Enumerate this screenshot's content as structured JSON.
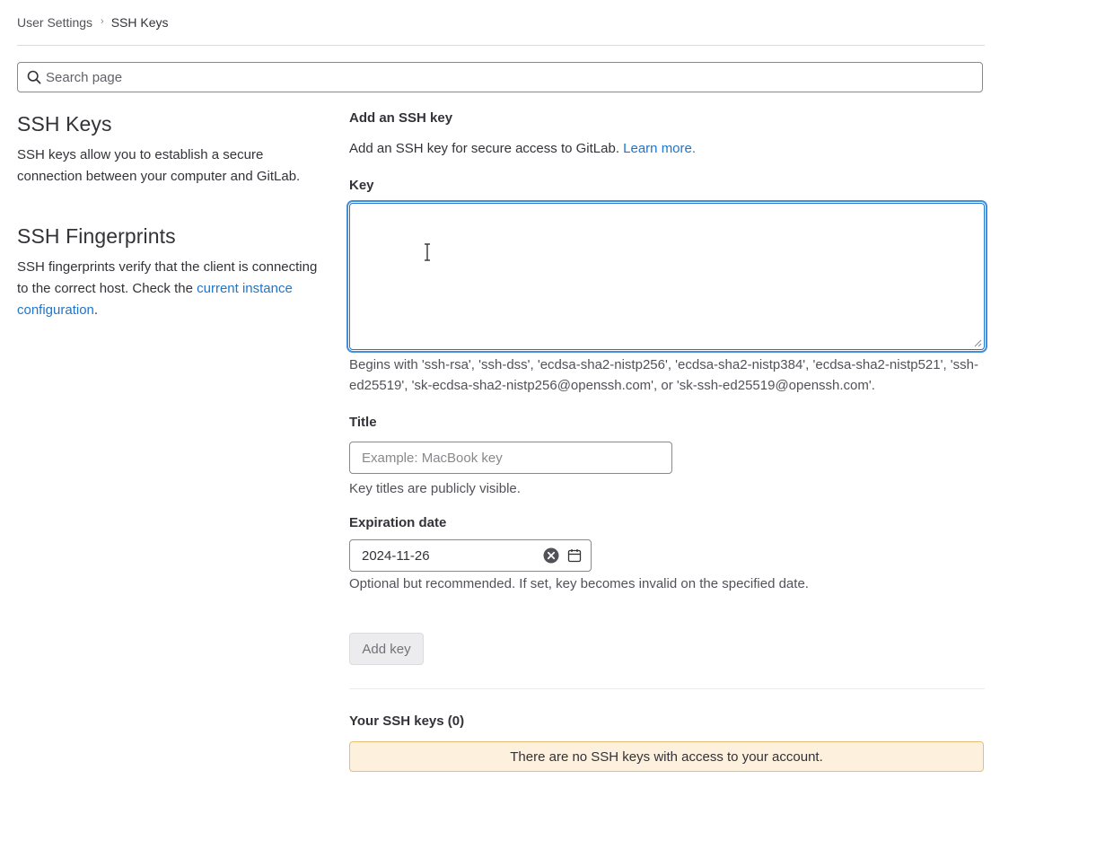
{
  "breadcrumb": {
    "parent": "User Settings",
    "separator": "›",
    "current": "SSH Keys"
  },
  "search": {
    "placeholder": "Search page",
    "value": "",
    "icon": "search-icon"
  },
  "left": {
    "ssh_keys": {
      "title": "SSH Keys",
      "description": "SSH keys allow you to establish a secure connection between your computer and GitLab."
    },
    "fingerprints": {
      "title": "SSH Fingerprints",
      "description_prefix": "SSH fingerprints verify that the client is connecting to the correct host. Check the ",
      "link_text": "current instance configuration",
      "description_suffix": "."
    }
  },
  "form": {
    "heading": "Add an SSH key",
    "intro_text": "Add an SSH key for secure access to GitLab. ",
    "learn_more": "Learn more.",
    "key_label": "Key",
    "key_value": "",
    "key_help": "Begins with 'ssh-rsa', 'ssh-dss', 'ecdsa-sha2-nistp256', 'ecdsa-sha2-nistp384', 'ecdsa-sha2-nistp521', 'ssh-ed25519', 'sk-ecdsa-sha2-nistp256@openssh.com', or 'sk-ssh-ed25519@openssh.com'.",
    "title_label": "Title",
    "title_placeholder": "Example: MacBook key",
    "title_value": "",
    "title_help": "Key titles are publicly visible.",
    "expiration_label": "Expiration date",
    "expiration_value": "2024-11-26",
    "expiration_help": "Optional but recommended. If set, key becomes invalid on the specified date.",
    "submit_label": "Add key"
  },
  "keys_list": {
    "heading": "Your SSH keys (0)",
    "empty_message": "There are no SSH keys with access to your account."
  },
  "colors": {
    "link": "#1f75cb",
    "focus_ring": "#428fdc",
    "alert_bg": "#fdf1dd",
    "alert_border": "#e9be74"
  }
}
